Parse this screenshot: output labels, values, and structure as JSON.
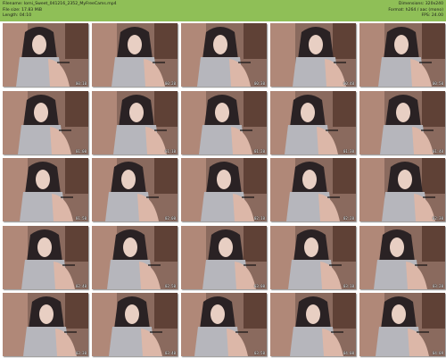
{
  "header": {
    "background": "#8fbf57",
    "left": [
      {
        "label": "Filename:",
        "value": "Iorni_Sweet_041216_2352_MyFreeCams.mp4"
      },
      {
        "label": "File size:",
        "value": "17.83 MiB"
      },
      {
        "label": "Length:",
        "value": "04:10"
      }
    ],
    "right": [
      {
        "label": "Dimensions:",
        "value": "320x240"
      },
      {
        "label": "Format:",
        "value": "h264 / aac (mono)"
      },
      {
        "label": "FPS:",
        "value": "24.00"
      }
    ]
  },
  "thumbnails": [
    {
      "time": "00:10"
    },
    {
      "time": "00:20"
    },
    {
      "time": "00:30"
    },
    {
      "time": "00:40"
    },
    {
      "time": "00:50"
    },
    {
      "time": "01:00"
    },
    {
      "time": "01:10"
    },
    {
      "time": "01:20"
    },
    {
      "time": "01:30"
    },
    {
      "time": "01:40"
    },
    {
      "time": "01:50"
    },
    {
      "time": "02:00"
    },
    {
      "time": "02:10"
    },
    {
      "time": "02:20"
    },
    {
      "time": "02:30"
    },
    {
      "time": "02:40"
    },
    {
      "time": "02:50"
    },
    {
      "time": "03:00"
    },
    {
      "time": "03:10"
    },
    {
      "time": "03:20"
    },
    {
      "time": "03:30"
    },
    {
      "time": "03:40"
    },
    {
      "time": "03:50"
    },
    {
      "time": "04:00"
    },
    {
      "time": "04:09"
    }
  ]
}
